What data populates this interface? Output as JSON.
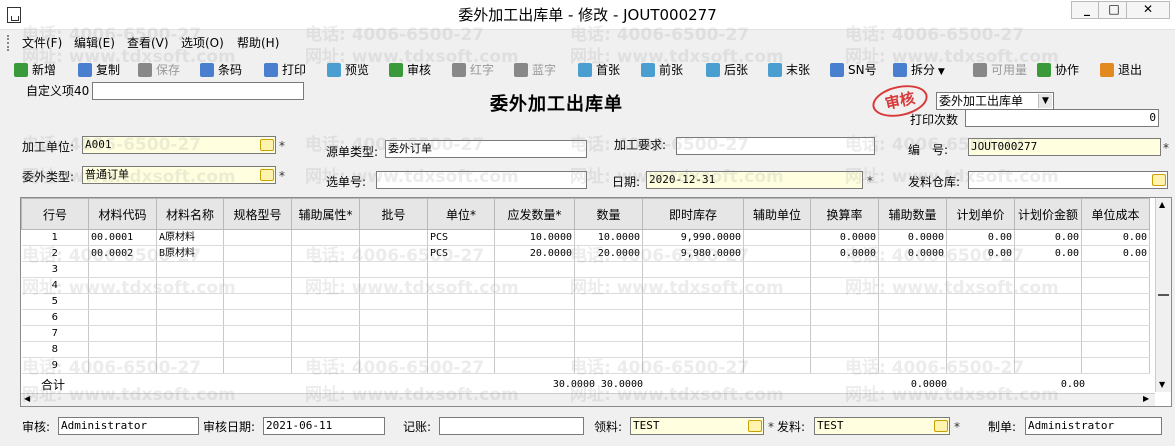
{
  "window": {
    "title": "委外加工出库单 - 修改 - JOUT000277",
    "btn_min": "_",
    "btn_max": "□",
    "btn_close": "✕"
  },
  "menu": [
    "文件(F)",
    "编辑(E)",
    "查看(V)",
    "选项(O)",
    "帮助(H)"
  ],
  "toolbar": [
    {
      "label": "新增",
      "icon": "add-icon",
      "color": "#3a9a3a",
      "disabled": false
    },
    {
      "label": "复制",
      "icon": "copy-icon",
      "color": "#4a7fd0",
      "disabled": false
    },
    {
      "label": "保存",
      "icon": "save-icon",
      "color": "#888888",
      "disabled": true
    },
    {
      "label": "条码",
      "icon": "barcode-icon",
      "color": "#4a7fd0",
      "disabled": false
    },
    {
      "label": "打印",
      "icon": "print-icon",
      "color": "#4a7fd0",
      "disabled": false
    },
    {
      "label": "预览",
      "icon": "preview-icon",
      "color": "#4a9fd0",
      "disabled": false
    },
    {
      "label": "审核",
      "icon": "audit-icon",
      "color": "#3a9a3a",
      "disabled": false
    },
    {
      "label": "红字",
      "icon": "red-text-icon",
      "color": "#888888",
      "disabled": true
    },
    {
      "label": "蓝字",
      "icon": "blue-text-icon",
      "color": "#888888",
      "disabled": true
    },
    {
      "label": "首张",
      "icon": "first-icon",
      "color": "#4a9fd0",
      "disabled": false
    },
    {
      "label": "前张",
      "icon": "prev-icon",
      "color": "#4a9fd0",
      "disabled": false
    },
    {
      "label": "后张",
      "icon": "next-icon",
      "color": "#4a9fd0",
      "disabled": false
    },
    {
      "label": "末张",
      "icon": "last-icon",
      "color": "#4a9fd0",
      "disabled": false
    },
    {
      "label": "SN号",
      "icon": "sn-icon",
      "color": "#4a7fd0",
      "disabled": false
    },
    {
      "label": "拆分",
      "icon": "split-icon",
      "color": "#4a7fd0",
      "disabled": false
    },
    {
      "label": "可用量",
      "icon": "available-icon",
      "color": "#888888",
      "disabled": true
    },
    {
      "label": "协作",
      "icon": "collab-icon",
      "color": "#3a9a3a",
      "disabled": false
    },
    {
      "label": "退出",
      "icon": "exit-icon",
      "color": "#e08a20",
      "disabled": false
    }
  ],
  "custom_field_label": "自定义项40",
  "doc_title": "委外加工出库单",
  "stamp": "审核",
  "doc_type_select": "委外加工出库单",
  "print_count_label": "打印次数",
  "print_count": "0",
  "form": {
    "unit_label": "加工单位:",
    "unit_value": "A001",
    "source_type_label": "源单类型:",
    "source_type_value": "委外订单",
    "requirement_label": "加工要求:",
    "requirement_value": "",
    "number_label": "编　号:",
    "number_value": "JOUT000277",
    "outsource_type_label": "委外类型:",
    "outsource_type_value": "普通订单",
    "select_no_label": "选单号:",
    "select_no_value": "",
    "date_label": "日期:",
    "date_value": "2020-12-31",
    "warehouse_label": "发料仓库:",
    "warehouse_value": ""
  },
  "watermark_texts": [
    "电话: 4006-6500-27",
    "网址: www.tdxsoft.com"
  ],
  "grid": {
    "columns": [
      "行号",
      "材料代码",
      "材料名称",
      "规格型号",
      "辅助属性*",
      "批号",
      "单位*",
      "应发数量*",
      "数量",
      "即时库存",
      "辅助单位",
      "换算率",
      "辅助数量",
      "计划单价",
      "计划价金额",
      "单位成本"
    ],
    "rows": [
      [
        "1",
        "00.0001",
        "A原材料",
        "",
        "",
        "",
        "PCS",
        "10.0000",
        "10.0000",
        "9,990.0000",
        "",
        "0.0000",
        "0.0000",
        "0.00",
        "0.00",
        "0.00"
      ],
      [
        "2",
        "00.0002",
        "B原材料",
        "",
        "",
        "",
        "PCS",
        "20.0000",
        "20.0000",
        "9,980.0000",
        "",
        "0.0000",
        "0.0000",
        "0.00",
        "0.00",
        "0.00"
      ],
      [
        "3",
        "",
        "",
        "",
        "",
        "",
        "",
        "",
        "",
        "",
        "",
        "",
        "",
        "",
        "",
        ""
      ],
      [
        "4",
        "",
        "",
        "",
        "",
        "",
        "",
        "",
        "",
        "",
        "",
        "",
        "",
        "",
        "",
        ""
      ],
      [
        "5",
        "",
        "",
        "",
        "",
        "",
        "",
        "",
        "",
        "",
        "",
        "",
        "",
        "",
        "",
        ""
      ],
      [
        "6",
        "",
        "",
        "",
        "",
        "",
        "",
        "",
        "",
        "",
        "",
        "",
        "",
        "",
        "",
        ""
      ],
      [
        "7",
        "",
        "",
        "",
        "",
        "",
        "",
        "",
        "",
        "",
        "",
        "",
        "",
        "",
        "",
        ""
      ],
      [
        "8",
        "",
        "",
        "",
        "",
        "",
        "",
        "",
        "",
        "",
        "",
        "",
        "",
        "",
        "",
        ""
      ],
      [
        "9",
        "",
        "",
        "",
        "",
        "",
        "",
        "",
        "",
        "",
        "",
        "",
        "",
        "",
        "",
        ""
      ]
    ],
    "total_label": "合计",
    "totals": {
      "应发数量*": "30.0000",
      "数量": "30.0000",
      "辅助数量": "0.0000",
      "计划价金额": "0.00"
    }
  },
  "footer": {
    "auditor_label": "审核:",
    "auditor_value": "Administrator",
    "audit_date_label": "审核日期:",
    "audit_date_value": "2021-06-11",
    "posting_label": "记账:",
    "posting_value": "",
    "picker_label": "领料:",
    "picker_value": "TEST",
    "issuer_label": "发料:",
    "issuer_value": "TEST",
    "maker_label": "制单:",
    "maker_value": "Administrator"
  }
}
